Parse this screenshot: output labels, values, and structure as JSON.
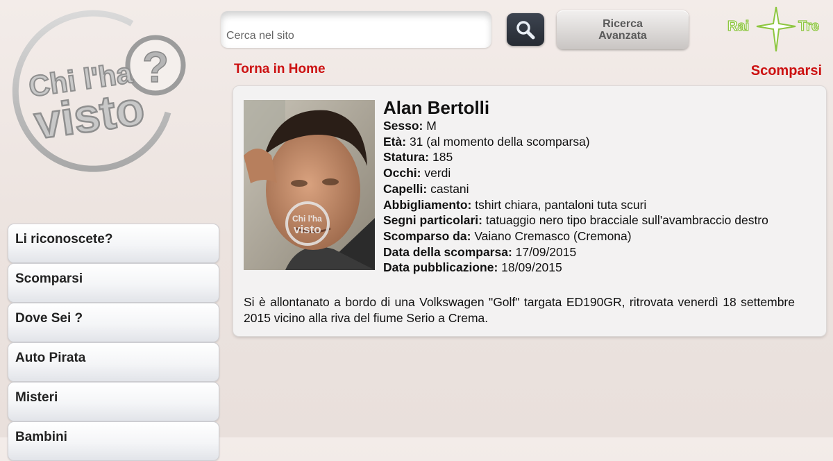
{
  "logo": {
    "text_line1": "Chi l'ha",
    "text_line2": "visto",
    "mark": "?"
  },
  "search": {
    "placeholder": "Cerca nel sito",
    "value": ""
  },
  "header": {
    "search_icon": "magnifier-icon",
    "advanced_label_line1": "Ricerca",
    "advanced_label_line2": "Avanzata",
    "rai_logo_left": "Rai",
    "rai_logo_right": "Tre"
  },
  "nav": {
    "home_link": "Torna in Home",
    "section_title": "Scomparsi"
  },
  "person": {
    "name": "Alan Bertolli",
    "photo_watermark_1": "Chi l'ha",
    "photo_watermark_2": "visto",
    "fields": [
      {
        "label": "Sesso:",
        "value": "M"
      },
      {
        "label": "Età:",
        "value": "31 (al momento della scomparsa)"
      },
      {
        "label": "Statura:",
        "value": "185"
      },
      {
        "label": "Occhi:",
        "value": "verdi"
      },
      {
        "label": "Capelli:",
        "value": "castani"
      },
      {
        "label": "Abbigliamento:",
        "value": "tshirt chiara, pantaloni tuta scuri"
      },
      {
        "label": "Segni particolari:",
        "value": "tatuaggio nero tipo bracciale sull'avambraccio destro"
      },
      {
        "label": "Scomparso da:",
        "value": "Vaiano Cremasco (Cremona)"
      },
      {
        "label": "Data della scomparsa:",
        "value": "17/09/2015"
      },
      {
        "label": "Data pubblicazione:",
        "value": "18/09/2015"
      }
    ],
    "description": "Si è allontanato a bordo di una Volkswagen \"Golf\" targata ED190GR, ritrovata venerdì 18 settembre 2015 vicino alla riva del fiume Serio a Crema."
  },
  "menu": {
    "items": [
      {
        "label": "Li riconoscete?"
      },
      {
        "label": "Scomparsi"
      },
      {
        "label": "Dove Sei ?"
      },
      {
        "label": "Auto Pirata"
      },
      {
        "label": "Misteri"
      },
      {
        "label": "Bambini"
      }
    ]
  },
  "colors": {
    "accent_red": "#cc1111",
    "rai_green": "#8dc63f"
  }
}
